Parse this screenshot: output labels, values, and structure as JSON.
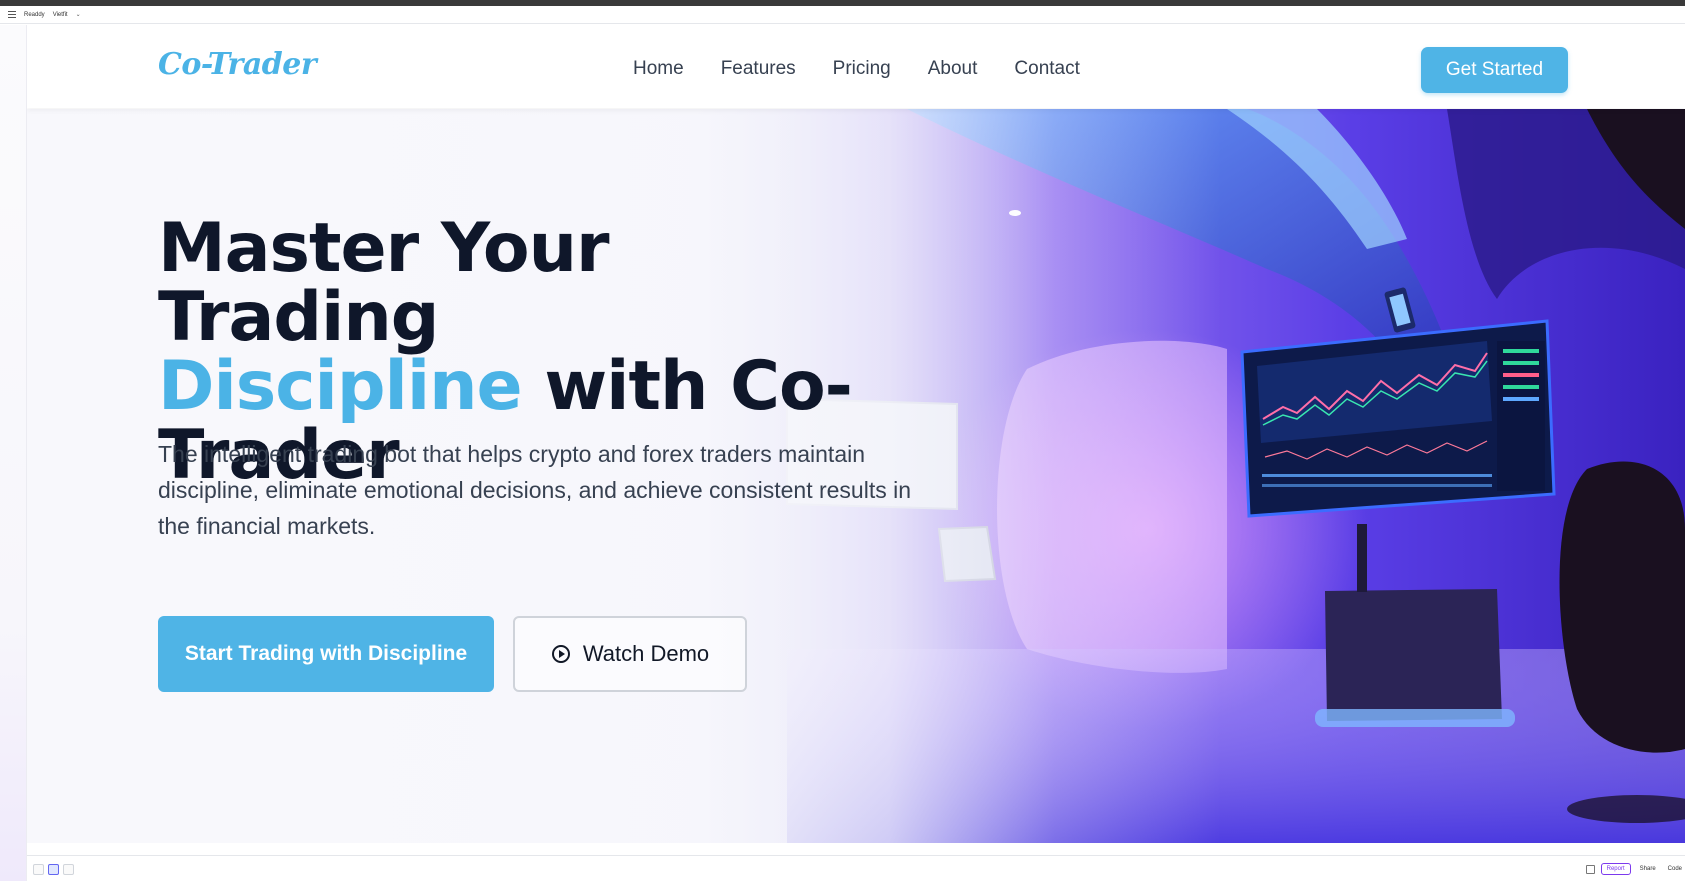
{
  "appbar": {
    "name": "Readdy",
    "workspace": "Vietfit",
    "dropdown_icon": "chevron-down-icon",
    "menu_icon": "hamburger-icon"
  },
  "nav": {
    "logo": "Co-Trader",
    "links": [
      "Home",
      "Features",
      "Pricing",
      "About",
      "Contact"
    ],
    "cta": "Get Started"
  },
  "hero": {
    "title_line1": "Master Your Trading",
    "title_accent": "Discipline",
    "title_rest": " with Co-Trader",
    "subtitle": "The intelligent trading bot that helps crypto and forex traders maintain discipline, eliminate emotional decisions, and achieve consistent results in the financial markets.",
    "primary_button": "Start Trading with Discipline",
    "secondary_button": "Watch Demo",
    "secondary_icon": "play-circle-icon",
    "background_image": "futuristic-trading-room-illustration"
  },
  "toolbar": {
    "report_label": "Report",
    "share_label": "Share",
    "code_label": "Code",
    "expand_icon": "expand-icon"
  },
  "colors": {
    "accent": "#4bb3e6",
    "button": "#4fb4e6",
    "headline": "#0f172a",
    "body_text": "#374151",
    "neon_purple": "#a855f7",
    "neon_blue": "#3b82f6"
  }
}
